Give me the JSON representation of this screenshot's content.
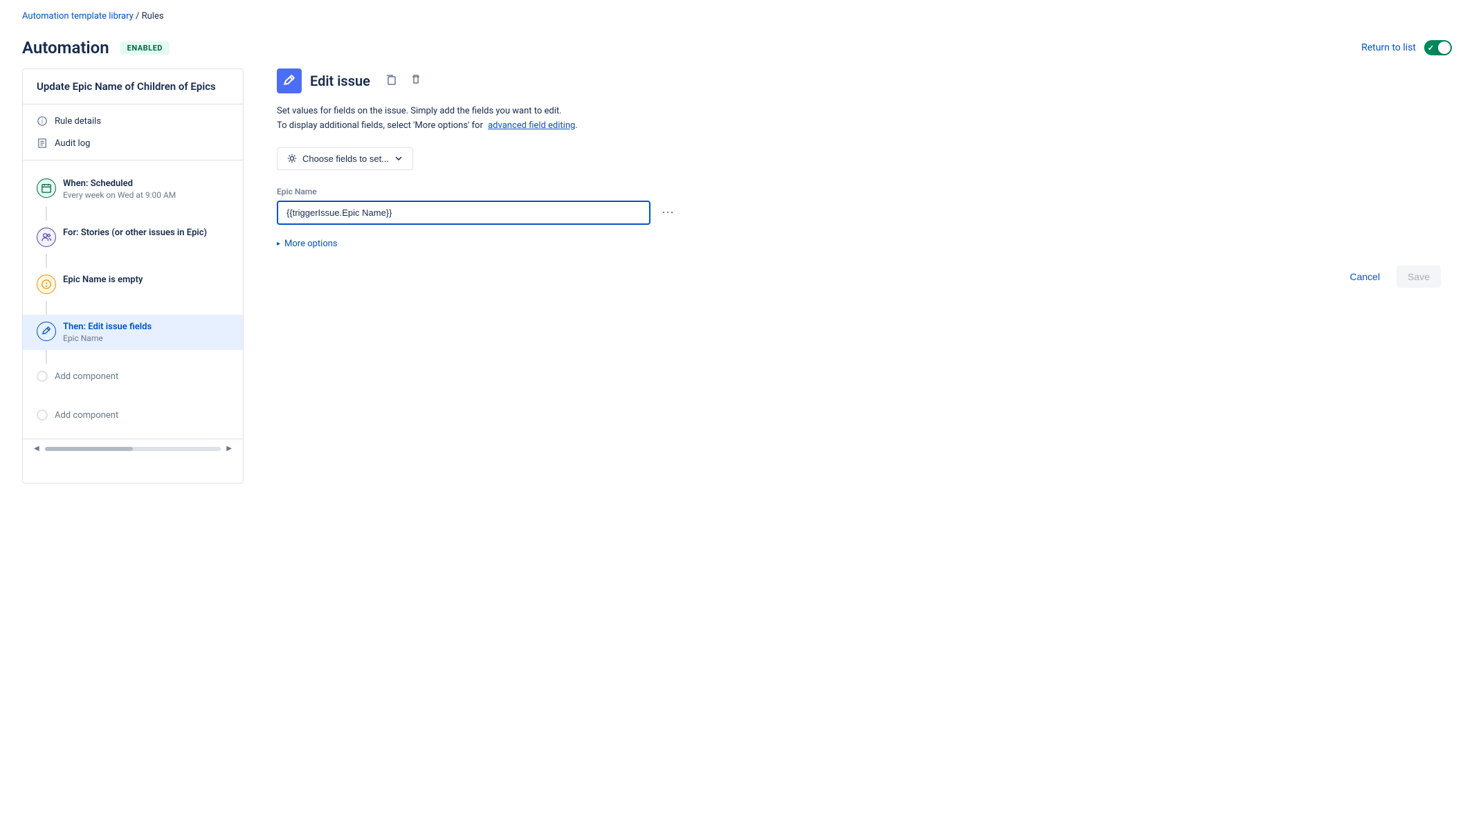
{
  "breadcrumb": {
    "library_link": "Automation template library",
    "separator": " / ",
    "current": "Rules"
  },
  "header": {
    "title": "Automation",
    "badge": "ENABLED",
    "return_to_list": "Return to list"
  },
  "sidebar": {
    "rule_name": "Update Epic Name of Children of Epics",
    "nav_items": [
      {
        "icon": "info-icon",
        "label": "Rule details"
      },
      {
        "icon": "audit-icon",
        "label": "Audit log"
      }
    ],
    "rule_items": [
      {
        "type": "scheduled",
        "icon": "calendar-icon",
        "title": "When: Scheduled",
        "subtitle": "Every week on Wed at 9:00 AM"
      },
      {
        "type": "for",
        "icon": "people-icon",
        "title": "For: Stories (or other issues in Epic)"
      },
      {
        "type": "condition",
        "icon": "condition-icon",
        "title": "Epic Name is empty"
      },
      {
        "type": "action",
        "icon": "pencil-icon",
        "title": "Then: Edit issue fields",
        "subtitle": "Epic Name",
        "active": true
      }
    ],
    "add_component_1": "Add component",
    "add_component_2": "Add component"
  },
  "edit_issue": {
    "title": "Edit issue",
    "description_line1": "Set values for fields on the issue. Simply add the fields you want to edit.",
    "description_line2": "To display additional fields, select 'More options' for",
    "advanced_link": "advanced field editing",
    "choose_fields_label": "Choose fields to set...",
    "epic_name_label": "Epic Name",
    "epic_name_value": "{{triggerIssue.Epic Name}}",
    "more_options_label": "More options",
    "cancel_label": "Cancel",
    "save_label": "Save"
  }
}
